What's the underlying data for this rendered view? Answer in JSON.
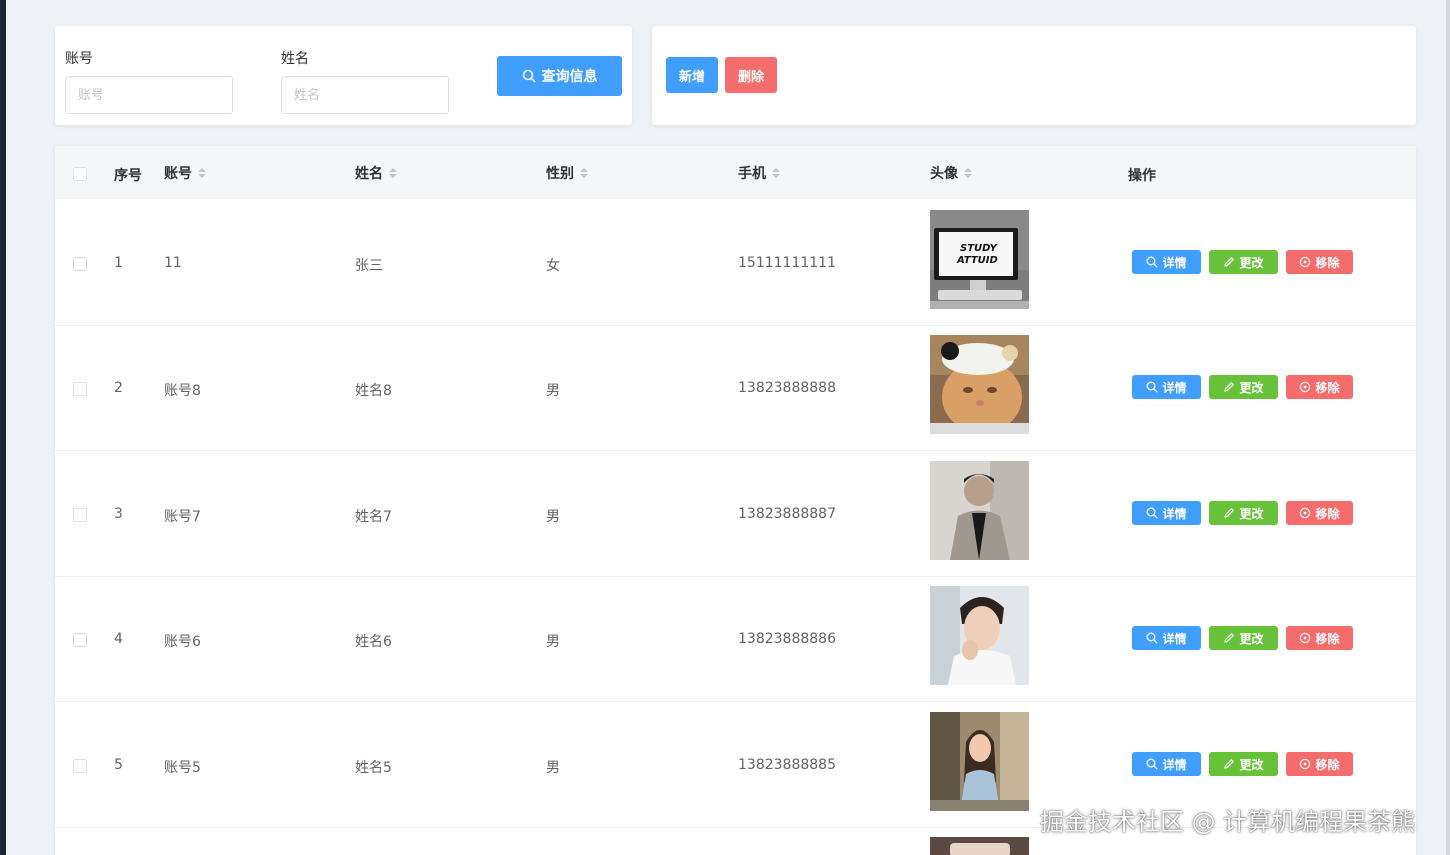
{
  "search": {
    "account_label": "账号",
    "account_placeholder": "账号",
    "name_label": "姓名",
    "name_placeholder": "姓名",
    "query_button": "查询信息"
  },
  "actions": {
    "add_button": "新增",
    "delete_button": "删除"
  },
  "table": {
    "headers": {
      "index": "序号",
      "account": "账号",
      "name": "姓名",
      "gender": "性别",
      "phone": "手机",
      "avatar": "头像",
      "operation": "操作"
    },
    "row_buttons": {
      "detail": "详情",
      "edit": "更改",
      "remove": "移除"
    },
    "rows": [
      {
        "index": "1",
        "account": "11",
        "name": "张三",
        "gender": "女",
        "phone": "15111111111",
        "avatar_text_1": "STUDY",
        "avatar_text_2": "ATTUID"
      },
      {
        "index": "2",
        "account": "账号8",
        "name": "姓名8",
        "gender": "男",
        "phone": "13823888888"
      },
      {
        "index": "3",
        "account": "账号7",
        "name": "姓名7",
        "gender": "男",
        "phone": "13823888887"
      },
      {
        "index": "4",
        "account": "账号6",
        "name": "姓名6",
        "gender": "男",
        "phone": "13823888886"
      },
      {
        "index": "5",
        "account": "账号5",
        "name": "姓名5",
        "gender": "男",
        "phone": "13823888885"
      }
    ]
  },
  "watermark": "掘金技术社区 @ 计算机编程果茶熊",
  "colors": {
    "primary": "#409eff",
    "success": "#67c23a",
    "danger": "#f56c6c",
    "background": "#eef1f6"
  },
  "icons": {
    "query": "search-icon",
    "detail": "search-icon",
    "edit": "pencil-icon",
    "remove": "close-circle-icon",
    "sort": "sort-caret-icon"
  }
}
